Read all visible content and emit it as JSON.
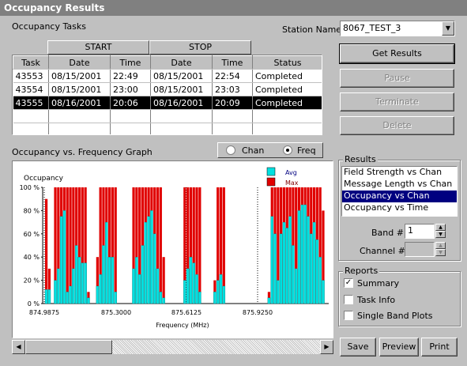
{
  "window": {
    "title": "Occupancy Results"
  },
  "tasks": {
    "label": "Occupancy Tasks",
    "group_headers": {
      "start": "START",
      "stop": "STOP"
    },
    "columns": [
      "Task",
      "Date",
      "Time",
      "Date",
      "Time",
      "Status"
    ],
    "rows": [
      {
        "task": "43553",
        "start_date": "08/15/2001",
        "start_time": "22:49",
        "stop_date": "08/15/2001",
        "stop_time": "22:54",
        "status": "Completed"
      },
      {
        "task": "43554",
        "start_date": "08/15/2001",
        "start_time": "23:00",
        "stop_date": "08/15/2001",
        "stop_time": "23:03",
        "status": "Completed"
      },
      {
        "task": "43555",
        "start_date": "08/16/2001",
        "start_time": "20:06",
        "stop_date": "08/16/2001",
        "stop_time": "20:09",
        "status": "Completed"
      }
    ],
    "selected_row": 2
  },
  "station": {
    "label": "Station Name",
    "value": "8067_TEST_3"
  },
  "buttons": {
    "get_results": "Get Results",
    "pause": "Pause",
    "terminate": "Terminate",
    "delete": "Delete",
    "save": "Save",
    "preview": "Preview",
    "print": "Print"
  },
  "graph": {
    "label": "Occupancy vs. Frequency Graph",
    "radio_chan": "Chan",
    "radio_freq": "Freq",
    "selected_mode": "Freq"
  },
  "results": {
    "label": "Results",
    "items": [
      "Field Strength vs Chan",
      "Message Length vs Chan",
      "Occupancy vs Chan",
      "Occupancy vs Time"
    ],
    "selected": 2,
    "band_label": "Band #",
    "band_value": "1",
    "channel_label": "Channel #",
    "channel_value": ""
  },
  "reports": {
    "label": "Reports",
    "summary": "Summary",
    "task_info": "Task Info",
    "single_band": "Single Band Plots",
    "summary_checked": true,
    "task_info_checked": false,
    "single_band_checked": false
  },
  "chart_data": {
    "type": "bar",
    "ylabel": "Occupancy",
    "xlabel": "Frequency (MHz)",
    "y_ticks": [
      "0 %",
      "20 %",
      "40 %",
      "60 %",
      "80 %",
      "100 %"
    ],
    "ylim": [
      0,
      100
    ],
    "x_ticks": [
      "874.9875",
      "875.3000",
      "875.6125",
      "875.9250"
    ],
    "legend": [
      "Avg",
      "Max"
    ],
    "colors": {
      "avg": "#00e0e0",
      "max": "#e00000"
    },
    "series": [
      {
        "name": "Avg",
        "values": [
          12,
          12,
          0,
          20,
          30,
          75,
          80,
          10,
          15,
          30,
          50,
          40,
          35,
          35,
          5,
          0,
          0,
          15,
          25,
          50,
          70,
          40,
          40,
          10,
          0,
          0,
          0,
          0,
          0,
          30,
          40,
          25,
          50,
          70,
          75,
          80,
          60,
          30,
          10,
          5,
          0,
          0,
          0,
          0,
          0,
          0,
          20,
          30,
          40,
          35,
          25,
          10,
          0,
          0,
          0,
          0,
          10,
          20,
          25,
          15,
          0,
          0,
          0,
          0,
          0,
          0,
          0,
          0,
          0,
          0,
          0,
          0,
          0,
          0,
          5,
          75,
          60,
          20,
          60,
          70,
          65,
          75,
          50,
          30,
          80,
          85,
          85,
          75,
          60,
          70,
          55,
          40,
          20,
          0
        ]
      },
      {
        "name": "Max",
        "values": [
          90,
          30,
          0,
          100,
          100,
          100,
          100,
          100,
          100,
          100,
          100,
          100,
          100,
          100,
          10,
          0,
          0,
          40,
          100,
          100,
          100,
          100,
          100,
          100,
          0,
          0,
          0,
          0,
          0,
          100,
          100,
          100,
          100,
          100,
          100,
          100,
          100,
          100,
          100,
          40,
          0,
          0,
          0,
          0,
          0,
          0,
          100,
          100,
          100,
          100,
          100,
          100,
          0,
          0,
          0,
          0,
          20,
          100,
          100,
          100,
          0,
          0,
          0,
          0,
          0,
          0,
          0,
          0,
          0,
          0,
          0,
          0,
          0,
          0,
          10,
          100,
          100,
          100,
          100,
          100,
          100,
          100,
          100,
          100,
          100,
          100,
          100,
          100,
          100,
          100,
          100,
          100,
          80,
          0
        ]
      }
    ]
  }
}
